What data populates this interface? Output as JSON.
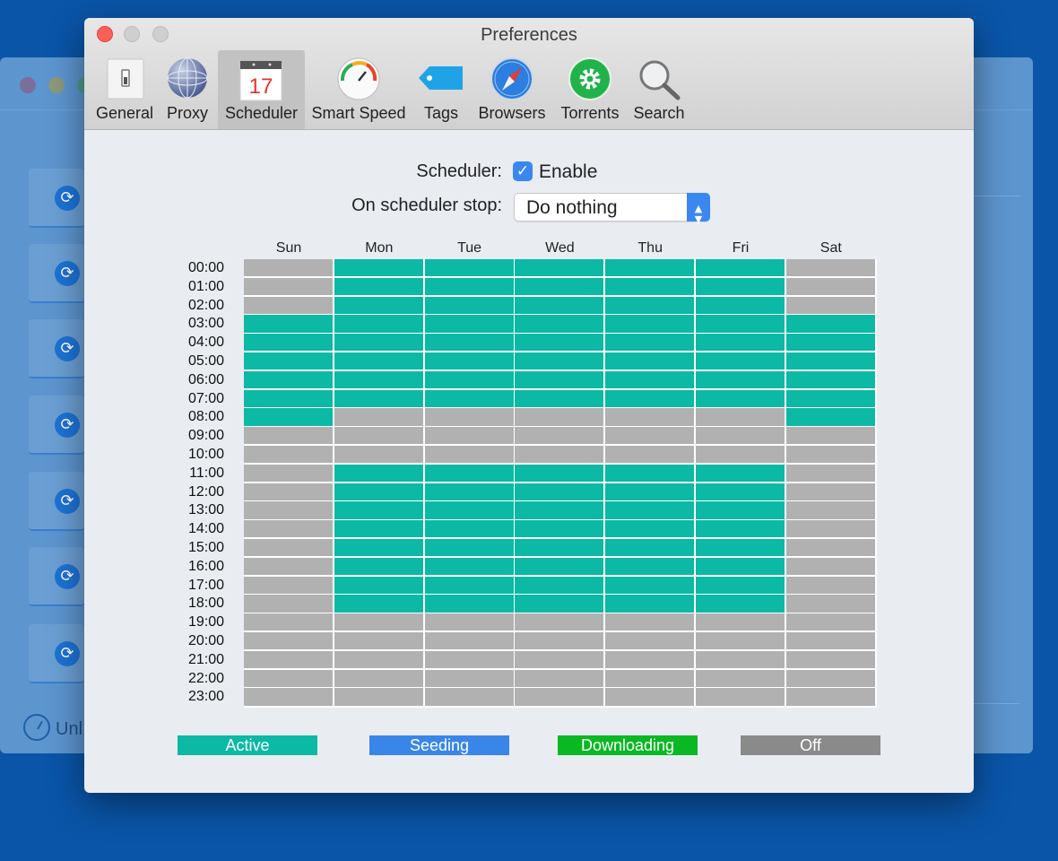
{
  "window": {
    "title": "Preferences"
  },
  "tabs": [
    {
      "label": "General",
      "icon": "switch-icon"
    },
    {
      "label": "Proxy",
      "icon": "globe-icon"
    },
    {
      "label": "Scheduler",
      "icon": "calendar-icon",
      "calendar_day": "17",
      "selected": true
    },
    {
      "label": "Smart Speed",
      "icon": "speedometer-icon"
    },
    {
      "label": "Tags",
      "icon": "tag-icon"
    },
    {
      "label": "Browsers",
      "icon": "compass-icon"
    },
    {
      "label": "Torrents",
      "icon": "gear-icon"
    },
    {
      "label": "Search",
      "icon": "magnifier-icon"
    }
  ],
  "scheduler": {
    "label": "Scheduler:",
    "enabled": true,
    "enable_label": "Enable",
    "stop_label": "On scheduler stop:",
    "stop_value": "Do nothing",
    "days": [
      "Sun",
      "Mon",
      "Tue",
      "Wed",
      "Thu",
      "Fri",
      "Sat"
    ],
    "hours": [
      "00:00",
      "01:00",
      "02:00",
      "03:00",
      "04:00",
      "05:00",
      "06:00",
      "07:00",
      "08:00",
      "09:00",
      "10:00",
      "11:00",
      "12:00",
      "13:00",
      "14:00",
      "15:00",
      "16:00",
      "17:00",
      "18:00",
      "19:00",
      "20:00",
      "21:00",
      "22:00",
      "23:00"
    ],
    "grid": [
      "OAAAAAO",
      "OAAAAAO",
      "OAAAAAO",
      "AAAAAAA",
      "AAAAAAA",
      "AAAAAAA",
      "AAAAAAA",
      "AAAAAAA",
      "AOOOOOA",
      "OOOOOOO",
      "OOOOOOO",
      "OAAAAAO",
      "OAAAAAO",
      "OAAAAAO",
      "OAAAAAO",
      "OAAAAAO",
      "OAAAAAO",
      "OAAAAAO",
      "OAAAAAO",
      "OOOOOOO",
      "OOOOOOO",
      "OOOOOOO",
      "OOOOOOO",
      "OOOOOOO"
    ]
  },
  "legend": [
    {
      "key": "A",
      "label": "Active",
      "color": "#0bb9a4"
    },
    {
      "key": "S",
      "label": "Seeding",
      "color": "#3a86e8"
    },
    {
      "key": "D",
      "label": "Downloading",
      "color": "#09b823"
    },
    {
      "key": "O",
      "label": "Off",
      "color": "#8a8a8a"
    }
  ],
  "grid_colors": {
    "A": "#0bb9a4",
    "O": "#b1b1b1"
  },
  "background_app": {
    "status_text": "Unl"
  }
}
